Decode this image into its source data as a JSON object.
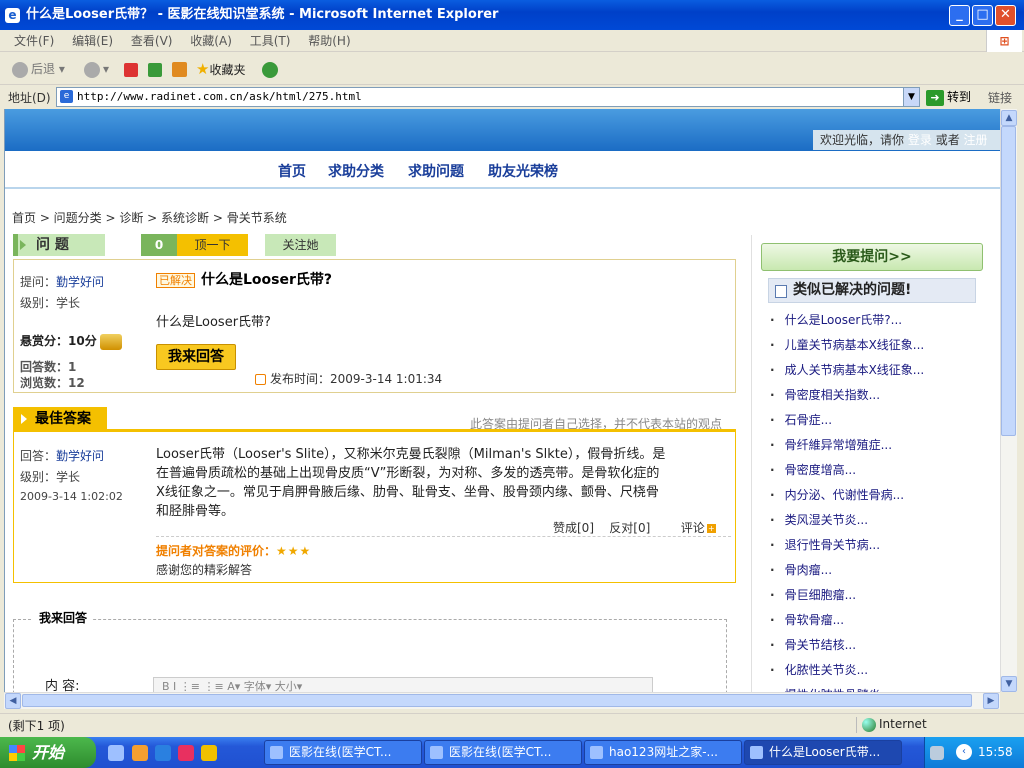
{
  "window": {
    "title": "什么是Looser氏带？ - 医影在线知识堂系统 - Microsoft Internet Explorer",
    "title_icon": "ie-icon",
    "minimize": "_",
    "maximize": "□",
    "close": "✕"
  },
  "menu": {
    "items": [
      "文件(F)",
      "编辑(E)",
      "查看(V)",
      "收藏(A)",
      "工具(T)",
      "帮助(H)"
    ]
  },
  "toolbar": {
    "back_label": "后退",
    "favorites_label": "收藏夹"
  },
  "address": {
    "label": "地址(D)",
    "url": "http://www.radinet.com.cn/ask/html/275.html",
    "go_label": "转到",
    "links_label": "链接"
  },
  "site": {
    "userbar": {
      "welcome": "欢迎光临，请你",
      "login": "登录",
      "or": "或者",
      "register": "注册"
    },
    "nav": [
      "首页",
      "求助分类",
      "求助问题",
      "助友光荣榜"
    ],
    "breadcrumb": "首页 > 问题分类 > 诊断 > 系统诊断 > 骨关节系统"
  },
  "question": {
    "header": "问 题",
    "vote_count": "0",
    "vote_label": "顶一下",
    "follow_label": "关注她",
    "asker_label": "提问：",
    "asker_name": "勤学好问",
    "level_label": "级别：学长",
    "reward_label": "悬赏分：10分",
    "answers_label": "回答数：1",
    "views_label": "浏览数：12",
    "solved_tag": "已解决",
    "title": "什么是Looser氏带?",
    "body": "什么是Looser氏带?",
    "answer_button": "我来回答",
    "pub_time": "发布时间：2009-3-14 1:01:34"
  },
  "best_answer": {
    "header": "最佳答案",
    "note": "此答案由提问者自己选择，并不代表本站的观点",
    "answerer_label": "回答：",
    "answerer_name": "勤学好问",
    "level_label": "级别：学长",
    "time": "2009-3-14 1:02:02",
    "body": "Looser氏带（Looser's Slite），又称米尔克曼氏裂隙（Milman's Slkte），假骨折线。是在普遍骨质疏松的基础上出现骨皮质“V”形断裂，为对称、多发的透亮带。是骨软化症的X线征象之一。常见于肩胛骨腋后缘、肋骨、耻骨支、坐骨、股骨颈内缘、颤骨、尺桡骨和胫腓骨等。",
    "agree_label": "赞成[0]",
    "oppose_label": "反对[0]",
    "comment_label": "评论",
    "rating_label": "提问者对答案的评价：",
    "rating_stars": "★★★",
    "rating_text": "感谢您的精彩解答"
  },
  "reply": {
    "title": "我来回答",
    "content_label": "内 容:",
    "editor_tools": "B  I  ⋮≡  ⋮≡   A▾ 字体▾ 大小▾"
  },
  "sidebar": {
    "ask_button": "我要提问>>",
    "similar_header": "类似已解决的问题!",
    "similar_items": [
      "什么是Looser氏带?...",
      "儿童关节病基本X线征象...",
      "成人关节病基本X线征象...",
      "骨密度相关指数...",
      "石骨症...",
      "骨纤維异常增殖症...",
      "骨密度增高...",
      "内分泌、代谢性骨病...",
      "类风湿关节炎...",
      "退行性骨关节病...",
      "骨肉瘤...",
      "骨巨细胞瘤...",
      "骨软骨瘤...",
      "骨关节结核...",
      "化脓性关节炎...",
      "慢性化脓性骨髓炎..."
    ]
  },
  "status": {
    "text": "(剩下1 项)",
    "zone": "Internet"
  },
  "taskbar": {
    "start": "开始",
    "tasks": [
      "医影在线(医学CT...",
      "医影在线(医学CT...",
      "hao123网址之家-...",
      "什么是Looser氏带..."
    ],
    "clock": "15:58"
  },
  "colors": {
    "accent_green": "#7ab55c",
    "accent_yellow": "#f4c000",
    "nav_blue": "#1a3e9a"
  }
}
